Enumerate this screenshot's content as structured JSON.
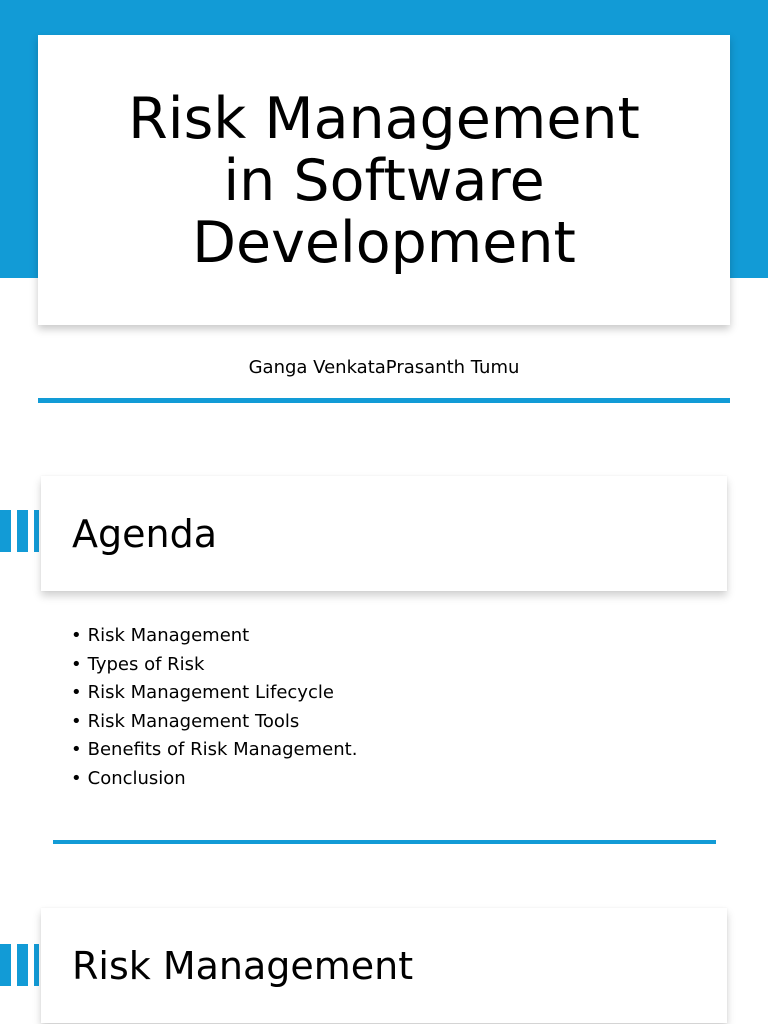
{
  "slide1": {
    "title_lines": [
      "Risk Management",
      "in Software",
      "Development"
    ],
    "author": "Ganga VenkataPrasanth Tumu"
  },
  "slide2": {
    "heading": "Agenda",
    "items": [
      "Risk Management",
      "Types of Risk",
      "Risk Management Lifecycle",
      "Risk Management Tools",
      "Benefits of Risk Management.",
      "Conclusion"
    ]
  },
  "slide3": {
    "heading": "Risk Management"
  },
  "colors": {
    "accent": "#129bd6",
    "background": "#ffffff",
    "text": "#000000"
  }
}
